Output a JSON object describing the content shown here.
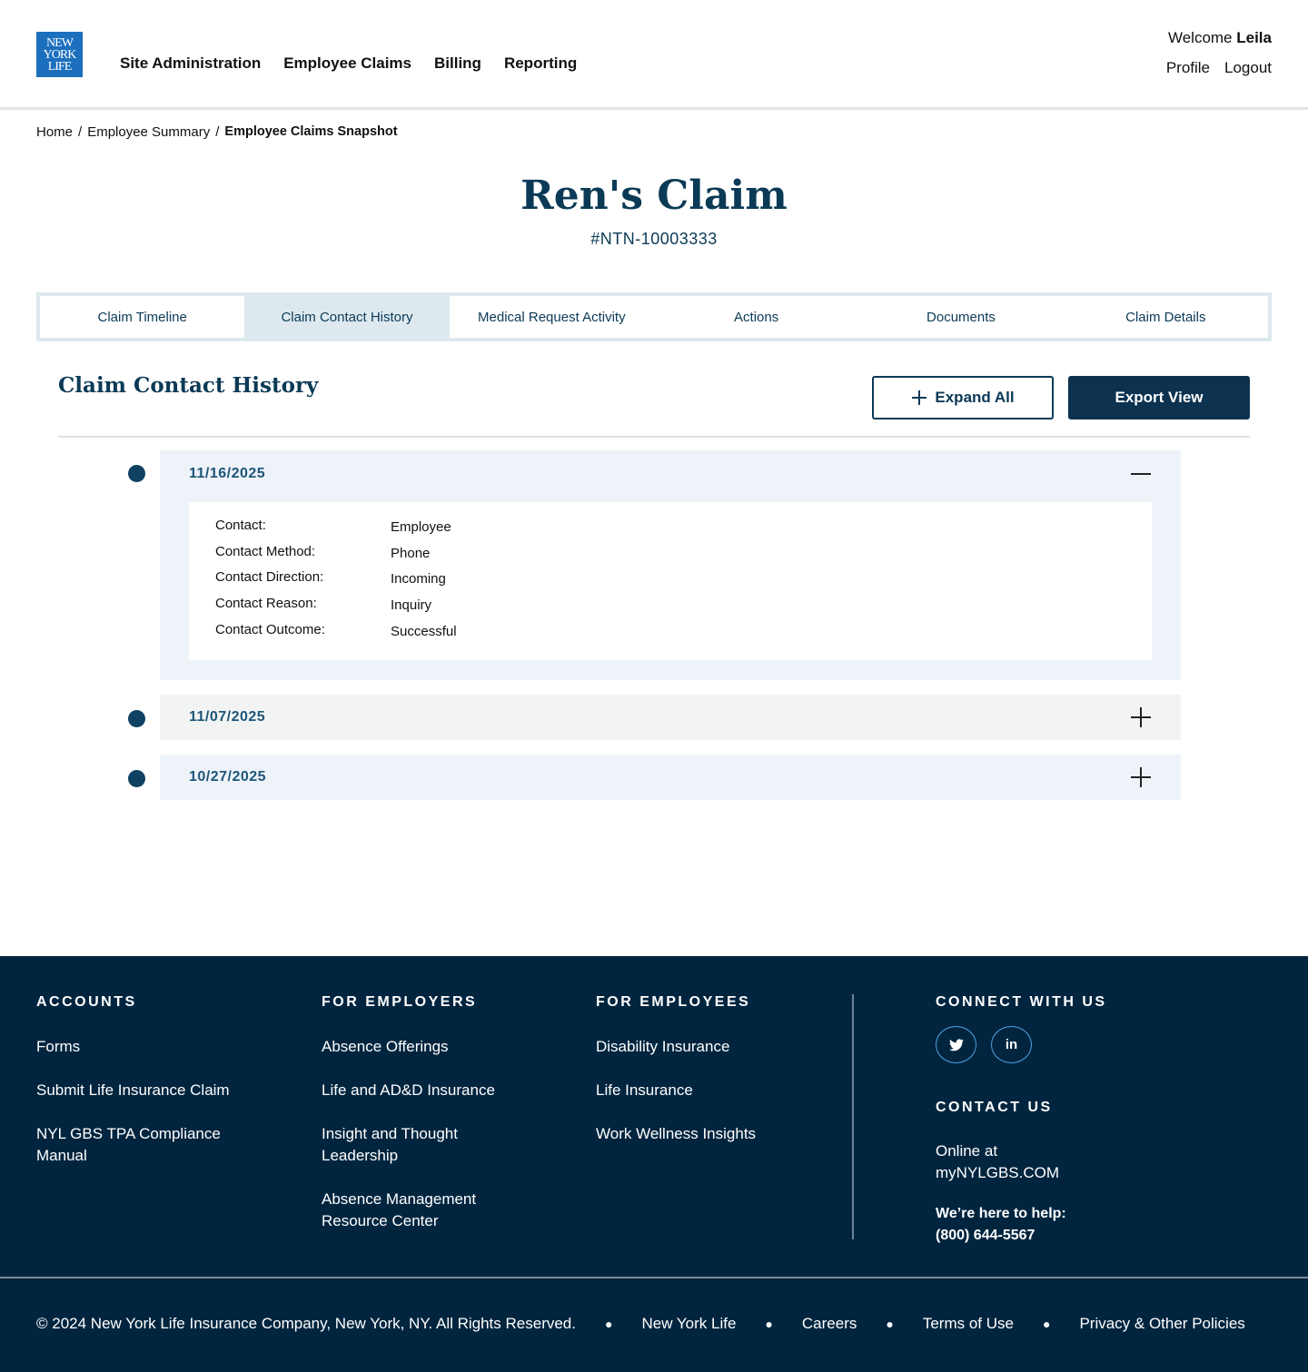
{
  "brand": {
    "logo_lines": [
      "NEW",
      "YORK",
      "LIFE"
    ],
    "color": "#1c6fbd"
  },
  "nav": {
    "items": [
      "Site Administration",
      "Employee Claims",
      "Billing",
      "Reporting"
    ]
  },
  "user": {
    "welcome": "Welcome",
    "name": "Leila",
    "profile": "Profile",
    "logout": "Logout"
  },
  "breadcrumb": [
    "Home",
    "Employee Summary",
    "Employee Claims Snapshot"
  ],
  "page": {
    "title": "Ren's Claim",
    "claim_number": "#NTN-10003333"
  },
  "tabs": [
    {
      "label": "Claim Timeline",
      "active": false
    },
    {
      "label": "Claim Contact History",
      "active": true
    },
    {
      "label": "Medical  Request Activity",
      "active": false
    },
    {
      "label": "Actions",
      "active": false
    },
    {
      "label": "Documents",
      "active": false
    },
    {
      "label": "Claim Details",
      "active": false
    }
  ],
  "section": {
    "title": "Claim Contact History",
    "expand_all": "Expand All",
    "export_view": "Export View"
  },
  "entries": [
    {
      "date": "11/16/2025",
      "expanded": true,
      "details": [
        {
          "label": "Contact:",
          "value": "Employee"
        },
        {
          "label": "Contact Method:",
          "value": "Phone"
        },
        {
          "label": "Contact Direction:",
          "value": "Incoming"
        },
        {
          "label": "Contact Reason:",
          "value": "Inquiry"
        },
        {
          "label": "Contact Outcome:",
          "value": "Successful"
        }
      ]
    },
    {
      "date": "11/07/2025",
      "expanded": false
    },
    {
      "date": "10/27/2025",
      "expanded": false
    }
  ],
  "footer": {
    "accounts": {
      "heading": "ACCOUNTS",
      "links": [
        "Forms",
        "Submit Life Insurance Claim",
        "NYL GBS TPA Compliance Manual"
      ]
    },
    "employers": {
      "heading": "FOR EMPLOYERS",
      "links": [
        "Absence Offerings",
        "Life and AD&D Insurance",
        "Insight and Thought Leadership",
        "Absence Management Resource Center"
      ]
    },
    "employees": {
      "heading": "FOR EMPLOYEES",
      "links": [
        "Disability Insurance",
        "Life Insurance",
        "Work Wellness Insights"
      ]
    },
    "connect": {
      "heading": "CONNECT WITH US",
      "social": [
        "twitter-icon",
        "linkedin-icon"
      ]
    },
    "contact": {
      "heading": "CONTACT US",
      "online": "Online at myNYLGBS.COM",
      "help_label": "We’re here to help:",
      "phone": "(800) 644-5567"
    },
    "copyright": "© 2024 New York Life Insurance Company, New York, NY. All Rights Reserved.",
    "bottom_links": [
      "New York Life",
      "Careers",
      "Terms of Use",
      "Privacy & Other Policies"
    ]
  },
  "colors": {
    "navy": "#0b3a56",
    "footer_bg": "#02253f",
    "tab_bg": "#dde9ef",
    "entry_bg_a": "#eef3fa",
    "entry_bg_b": "#f2f4f3"
  }
}
